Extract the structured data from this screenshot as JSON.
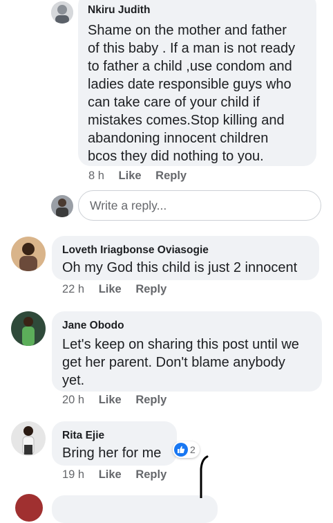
{
  "comments": [
    {
      "name": "Nkiru Judith",
      "text": "Shame on the  mother and father\nof this baby . If a man is not ready\nto father a child ,use condom and\nladies date responsible guys who\ncan take care of your child if\nmistakes comes.Stop killing  and\nabandoning innocent children\nbcos they did nothing to you.",
      "time": "8 h",
      "like": "Like",
      "reply": "Reply"
    },
    {
      "name": "Loveth Iriagbonse Oviasogie",
      "text": "Oh my God this child is just 2 innocent",
      "time": "22 h",
      "like": "Like",
      "reply": "Reply"
    },
    {
      "name": "Jane Obodo",
      "text": "Let's keep on sharing this post until we\nget her parent. Don't blame anybody\nyet.",
      "time": "20 h",
      "like": "Like",
      "reply": "Reply"
    },
    {
      "name": "Rita Ejie",
      "text": "Bring her for me",
      "time": "19 h",
      "like": "Like",
      "reply": "Reply",
      "reaction_icon": "like-icon",
      "reaction_count": "2"
    }
  ],
  "reply_composer": {
    "placeholder": "Write a reply..."
  },
  "colors": {
    "bubble": "#f0f2f5",
    "meta_text": "#65676b",
    "like_blue": "#1877f2"
  }
}
